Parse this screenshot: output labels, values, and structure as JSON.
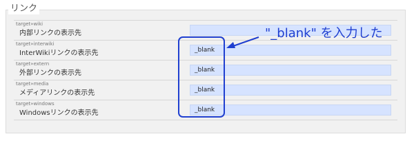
{
  "section": {
    "legend": "リンク"
  },
  "rows": [
    {
      "key": "target»wiki",
      "label": "内部リンクの表示先",
      "value": ""
    },
    {
      "key": "target»interwiki",
      "label": "InterWikiリンクの表示先",
      "value": "_blank"
    },
    {
      "key": "target»extern",
      "label": "外部リンクの表示先",
      "value": "_blank"
    },
    {
      "key": "target»media",
      "label": "メディアリンクの表示先",
      "value": "_blank"
    },
    {
      "key": "target»windows",
      "label": "Windowsリンクの表示先",
      "value": "_blank"
    }
  ],
  "annotation": {
    "text": "\"_blank\" を入力した",
    "color": "#1f3fd0"
  }
}
